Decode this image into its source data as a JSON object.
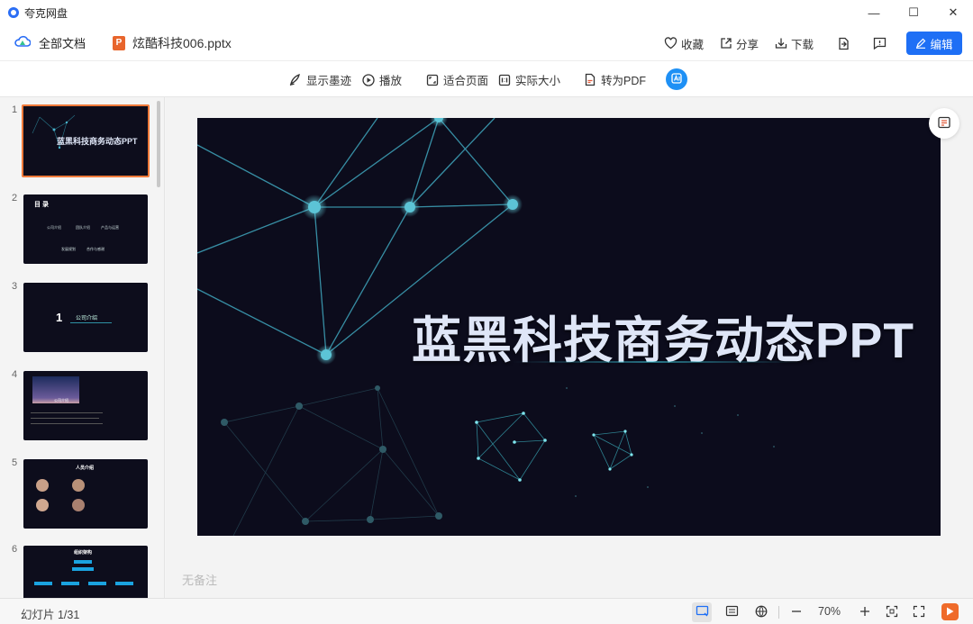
{
  "window": {
    "title": "夸克网盘",
    "controls": [
      "—",
      "☐",
      "✕"
    ]
  },
  "header": {
    "all_docs": "全部文档",
    "file_name": "炫酷科技006.pptx",
    "file_badge": "P",
    "actions": {
      "favorite": "收藏",
      "share": "分享",
      "download": "下载",
      "edit": "编辑"
    }
  },
  "toolbar": {
    "show_ink": "显示墨迹",
    "play": "播放",
    "fit_page": "适合页面",
    "actual_size": "实际大小",
    "to_pdf": "转为PDF"
  },
  "thumbnails": [
    {
      "num": "1",
      "title": "蓝黑科技商务动态PPT"
    },
    {
      "num": "2",
      "title": "目 录",
      "items": [
        "公司介绍",
        "团队介绍",
        "产品与运营",
        "发展规划",
        "合作与感谢"
      ]
    },
    {
      "num": "3",
      "badge": "1",
      "title": "公司介绍"
    },
    {
      "num": "4",
      "title": "公司介绍"
    },
    {
      "num": "5",
      "title": "人员介绍"
    },
    {
      "num": "6",
      "title": "组织架构"
    }
  ],
  "slide": {
    "title": "蓝黑科技商务动态PPT"
  },
  "notes": "无备注",
  "status": {
    "slide_count": "幻灯片 1/31",
    "zoom": "70%"
  },
  "colors": {
    "accent": "#1e6ff5",
    "selection": "#ef7a3a",
    "slide_bg": "#0c0c1c",
    "node": "#4fb8cf"
  }
}
